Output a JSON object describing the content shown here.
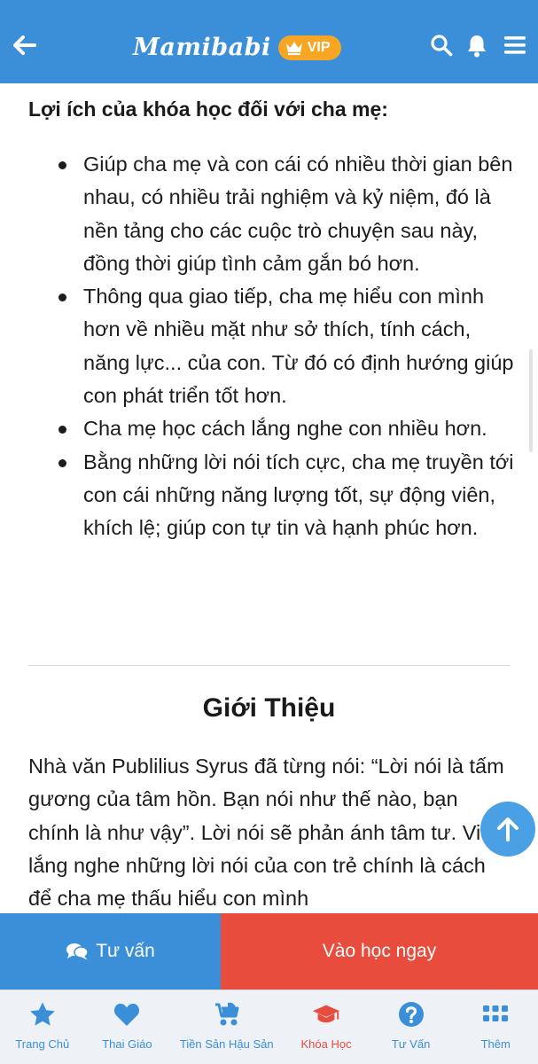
{
  "header": {
    "brand_name": "Mamibabi",
    "vip_label": "VIP",
    "icons": [
      "back-arrow-icon",
      "crown-icon",
      "search-icon",
      "bell-icon",
      "menu-icon"
    ]
  },
  "content": {
    "benefits_title": "Lợi ích của khóa học đối với cha mẹ:",
    "benefits": [
      "Giúp cha mẹ và con cái có nhiều thời gian bên nhau, có nhiều trải nghiệm và kỷ niệm, đó là nền tảng cho các cuộc trò chuyện sau này, đồng thời giúp tình cảm gắn bó hơn.",
      "Thông qua giao tiếp, cha mẹ hiểu con mình hơn về nhiều mặt như sở thích, tính cách, năng lực... của con. Từ đó có định hướng giúp con phát triển tốt hơn.",
      "Cha mẹ học cách lắng nghe con nhiều hơn.",
      "Bằng những lời nói tích cực, cha mẹ truyền tới con cái những năng lượng tốt, sự động viên, khích lệ; giúp con tự tin và hạnh phúc hơn."
    ],
    "intro_heading": "Giới Thiệu",
    "intro_text": "Nhà văn Publilius Syrus đã từng nói: “Lời nói là tấm gương của tâm hồn. Bạn nói như thế nào, bạn chính là như vậy”. Lời nói sẽ phản ánh tâm tư. Việc lắng nghe những lời nói của con trẻ chính là cách để cha mẹ thấu hiểu con mình"
  },
  "actions": {
    "advise_label": "Tư vấn",
    "learn_label": "Vào học ngay"
  },
  "bottom_nav": {
    "active_index": 3,
    "items": [
      {
        "label": "Trang Chủ",
        "icon": "star-icon"
      },
      {
        "label": "Thai Giáo",
        "icon": "heart-icon"
      },
      {
        "label": "Tiền Sản Hậu Sản",
        "icon": "stroller-icon"
      },
      {
        "label": "Khóa Học",
        "icon": "graduation-cap-icon"
      },
      {
        "label": "Tư Vấn",
        "icon": "question-icon"
      },
      {
        "label": "Thêm",
        "icon": "grid-icon"
      }
    ]
  },
  "colors": {
    "primary_blue": "#3a8fd8",
    "accent_red": "#e84c3d",
    "vip_orange": "#f6a623",
    "nav_background": "#eef2f7"
  }
}
